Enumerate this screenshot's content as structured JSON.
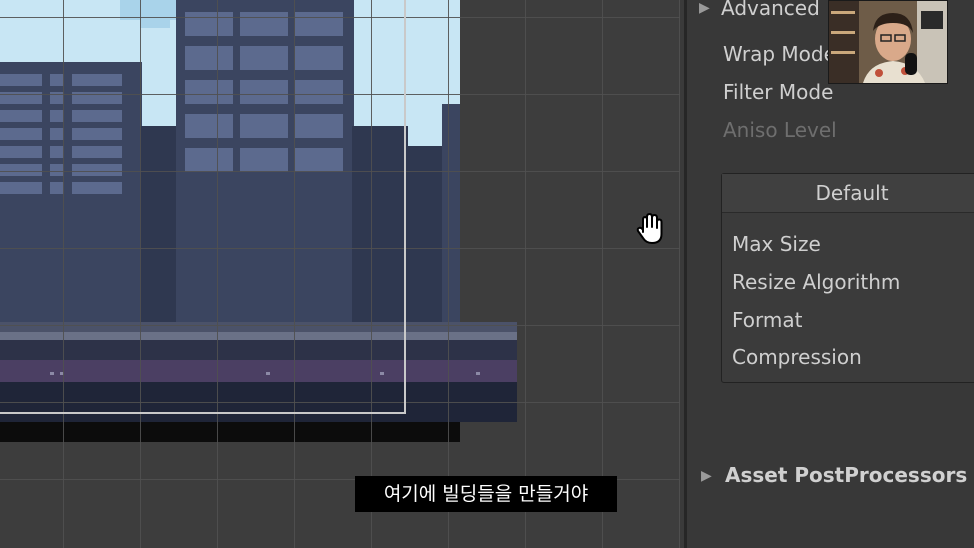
{
  "inspector": {
    "advanced_label": "Advanced",
    "wrap_mode_label": "Wrap Mode",
    "filter_mode_label": "Filter Mode",
    "aniso_level_label": "Aniso Level",
    "platform_tab": "Default",
    "max_size_label": "Max Size",
    "resize_algorithm_label": "Resize Algorithm",
    "format_label": "Format",
    "compression_label": "Compression",
    "asset_postprocessors_label": "Asset PostProcessors"
  },
  "subtitle": {
    "text": "여기에 빌딩들을 만들거야"
  },
  "icons": {
    "cursor": "hand-pan-icon",
    "expand": "triangle-right-icon"
  },
  "colors": {
    "sky": "#c8e6f4",
    "building": "#3b4560",
    "window": "#5c6a8e",
    "panel": "#383838"
  }
}
